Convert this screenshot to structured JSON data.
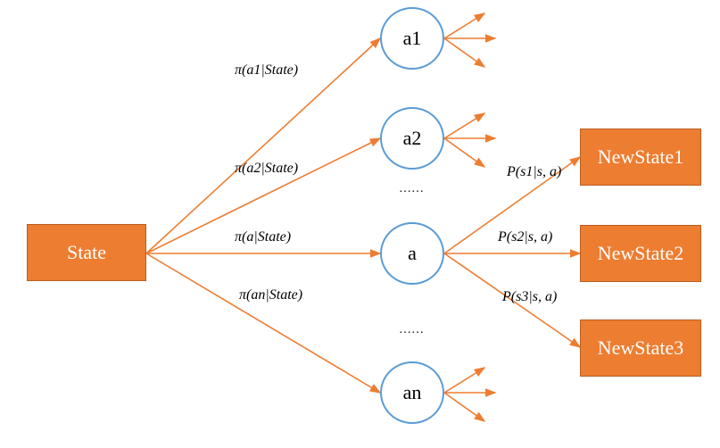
{
  "colors": {
    "edge": "#ED7D31",
    "box_fill": "#ED7D31",
    "circle_stroke": "#5B9BD5"
  },
  "state": "State",
  "actions": [
    "a1",
    "a2",
    "a",
    "an"
  ],
  "ellipsis": "……",
  "new_states": [
    "NewState1",
    "NewState2",
    "NewState3"
  ],
  "policy_labels": [
    "π(a1|State)",
    "π(a2|State)",
    "π(a|State)",
    "π(an|State)"
  ],
  "transition_labels": [
    "P(s1|s, a)",
    "P(s2|s, a)",
    "P(s3|s, a)"
  ]
}
